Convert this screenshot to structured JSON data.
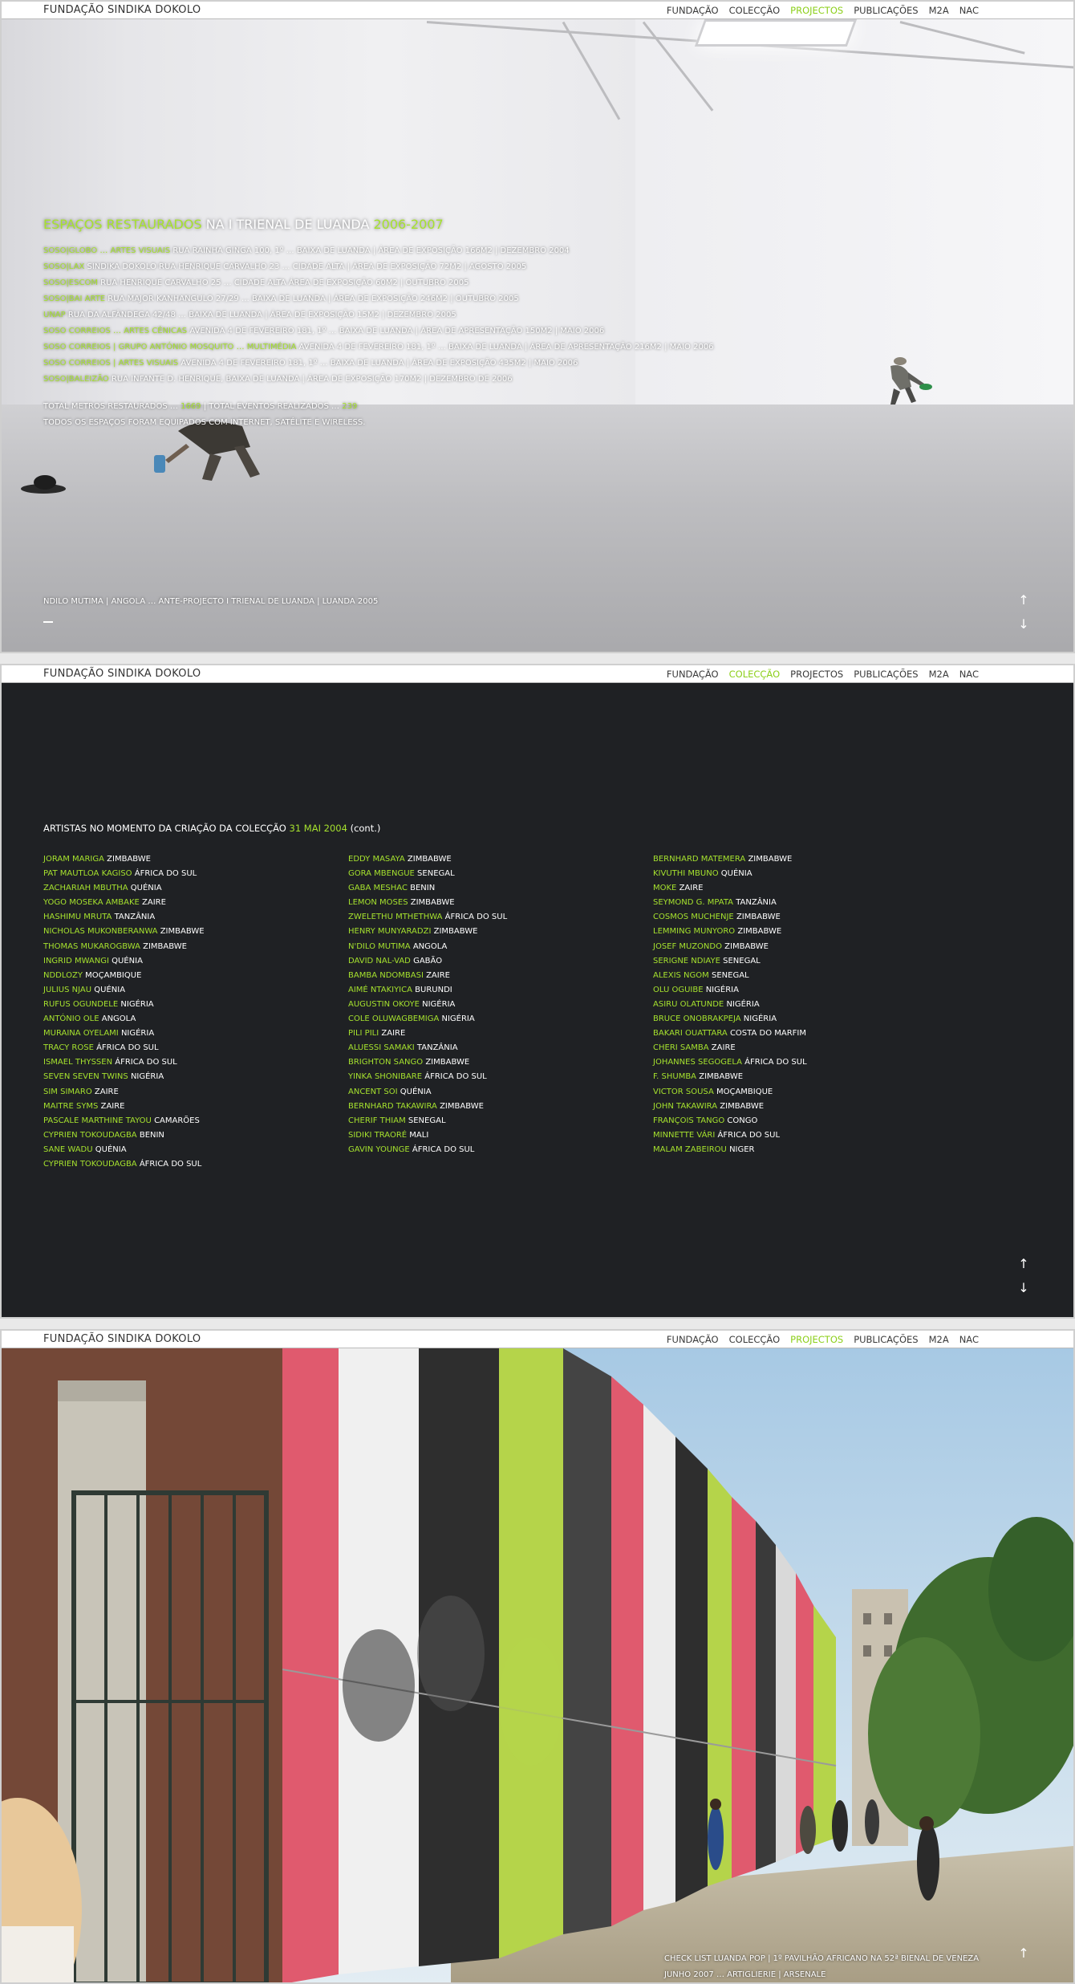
{
  "brand": "FUNDAÇÃO SINDIKA DOKOLO",
  "nav": [
    "FUNDAÇÃO",
    "COLECÇÃO",
    "PROJECTOS",
    "PUBLICAÇÕES",
    "M2A",
    "NAC"
  ],
  "accent_color": "#a6e22e",
  "section1": {
    "active_nav": "PROJECTOS",
    "title": {
      "part1": "ESPAÇOS RESTAURADOS",
      "part2": " NA I TRIENAL DE LUANDA ",
      "part3": "2006-2007"
    },
    "spaces": [
      {
        "name": "SOSO|GLOBO … ARTES VISUAIS",
        "details": " RUA RAINHA GINGA 100, 1º … BAIXA DE LUANDA | ÁREA DE EXPOSIÇÃO 166M2 | DEZEMBRO 2004"
      },
      {
        "name": "SOSO|LAX",
        "details": " SINDIKA DOKOLO RUA HENRIQUE CARVALHO 23 … CIDADE ALTA | ÁREA DE EXPOSIÇÃO 72M2 | AGOSTO 2005"
      },
      {
        "name": "SOSO|ESCOM",
        "details": " RUA HENRIQUE CARVALHO 25 … CIDADE ALTA ÁREA DE EXPOSIÇÃO 60M2 | OUTUBRO 2005"
      },
      {
        "name": "SOSO|BAI ARTE",
        "details": " RUA MAJOR KANHANGULO 27/29 … BAIXA DE LUANDA | ÁREA DE EXPOSIÇÃO 246M2 | OUTUBRO 2005"
      },
      {
        "name": "UNAP",
        "details": " RUA DA ALFÂNDEGA 42/48 … BAIXA DE LUANDA | ÁREA DE EXPOSIÇÃO 15M2 | DEZEMBRO 2005"
      },
      {
        "name": "SOSO CORREIOS … ARTES CÉNICAS",
        "details": " AVENIDA 4 DE FEVEREIRO 181, 1º … BAIXA DE LUANDA | ÁREA DE APRESENTAÇÃO 150M2 | MAIO 2006"
      },
      {
        "name": "SOSO CORREIOS | GRUPO ANTÓNIO MOSQUITO … MULTIMÉDIA",
        "details": " AVENIDA 4 DE FEVEREIRO 181, 1º … BAIXA DE LUANDA | ÁREA DE APRESENTAÇÃO 216M2 | MAIO 2006"
      },
      {
        "name": "SOSO CORREIOS | ARTES VISUAIS",
        "details": " AVENIDA 4 DE FEVEREIRO 181, 1º … BAIXA DE LUANDA | ÁREA DE EXPOSIÇÃO 435M2 | MAIO 2006"
      },
      {
        "name": "SOSO|BALEIZÃO",
        "details": " RUA INFANTE D. HENRIQUE, BAIXA DE LUANDA | ÁREA DE EXPOSIÇÃO 170M2 | DEZEMBRO DE 2006"
      }
    ],
    "totals": {
      "label1": "TOTAL METROS RESTAURADOS … ",
      "value1": "1669",
      "label2": " | TOTAL EVENTOS REALIZADOS … ",
      "value2": "239"
    },
    "equipped_note": "TODOS OS ESPAÇOS FORAM EQUIPADOS COM INTERNET, SATÉLITE E WIRELESS.",
    "caption": "NDILO MUTIMA | ANGOLA … ANTE-PROJECTO I TRIENAL DE LUANDA | LUANDA 2005",
    "arrow_up": "↑",
    "arrow_down": "↓"
  },
  "section2": {
    "active_nav": "COLECÇÃO",
    "heading": {
      "part1": "ARTISTAS NO MOMENTO DA CRIAÇÃO DA COLECÇÃO ",
      "date": "31 MAI 2004",
      "part2": " (cont.)"
    },
    "columns": [
      [
        {
          "name": "JORAM MARIGA",
          "country": "ZIMBABWE"
        },
        {
          "name": "PAT MAUTLOA KAGISO",
          "country": "ÁFRICA DO SUL"
        },
        {
          "name": "ZACHARIAH MBUTHA",
          "country": "QUÉNIA"
        },
        {
          "name": "YOGO MOSEKA AMBAKE",
          "country": "ZAIRE"
        },
        {
          "name": "HASHIMU MRUTA",
          "country": "TANZÂNIA"
        },
        {
          "name": "NICHOLAS MUKONBERANWA",
          "country": "ZIMBABWE"
        },
        {
          "name": "THOMAS MUKAROGBWA",
          "country": "ZIMBABWE"
        },
        {
          "name": "INGRID MWANGI",
          "country": "QUÉNIA"
        },
        {
          "name": "NDDLOZY",
          "country": "MOÇAMBIQUE"
        },
        {
          "name": "JULIUS NJAU",
          "country": "QUÉNIA"
        },
        {
          "name": "RUFUS OGUNDELE",
          "country": "NIGÉRIA"
        },
        {
          "name": "ANTÓNIO OLE",
          "country": "ANGOLA"
        },
        {
          "name": "MURAINA OYELAMI",
          "country": "NIGÉRIA"
        },
        {
          "name": "TRACY ROSE",
          "country": "ÁFRICA DO SUL"
        },
        {
          "name": "ISMAEL THYSSEN",
          "country": "ÁFRICA DO SUL"
        },
        {
          "name": "SEVEN SEVEN TWINS",
          "country": "NIGÉRIA"
        },
        {
          "name": "SIM SIMARO",
          "country": "ZAIRE"
        },
        {
          "name": "MAITRE SYMS",
          "country": "ZAIRE"
        },
        {
          "name": "PASCALE MARTHINE TAYOU",
          "country": "CAMARÕES"
        },
        {
          "name": "CYPRIEN TOKOUDAGBA",
          "country": "BENIN"
        },
        {
          "name": "SANE WADU",
          "country": "QUÉNIA"
        },
        {
          "name": "CYPRIEN TOKOUDAGBA",
          "country": "ÁFRICA DO SUL"
        }
      ],
      [
        {
          "name": "EDDY MASAYA",
          "country": "ZIMBABWE"
        },
        {
          "name": "GORA MBENGUE",
          "country": "SENEGAL"
        },
        {
          "name": "GABA MESHAC",
          "country": "BENIN"
        },
        {
          "name": "LEMON MOSES",
          "country": "ZIMBABWE"
        },
        {
          "name": "ZWELETHU MTHETHWA",
          "country": "ÁFRICA DO SUL"
        },
        {
          "name": "HENRY MUNYARADZI",
          "country": "ZIMBABWE"
        },
        {
          "name": "N'DILO MUTIMA",
          "country": "ANGOLA"
        },
        {
          "name": "DAVID NAL-VAD",
          "country": "GABÃO"
        },
        {
          "name": "BAMBA NDOMBASI",
          "country": "ZAIRE"
        },
        {
          "name": "AIMÉ NTAKIYICA",
          "country": "BURUNDI"
        },
        {
          "name": "AUGUSTIN OKOYE",
          "country": "NIGÉRIA"
        },
        {
          "name": "COLE OLUWAGBEMIGA",
          "country": "NIGÉRIA"
        },
        {
          "name": "PILI PILI",
          "country": "ZAIRE"
        },
        {
          "name": "ALUESSI SAMAKI",
          "country": "TANZÂNIA"
        },
        {
          "name": "BRIGHTON SANGO",
          "country": "ZIMBABWE"
        },
        {
          "name": "YINKA SHONIBARE",
          "country": "ÁFRICA DO SUL"
        },
        {
          "name": "ANCENT SOI",
          "country": "QUÉNIA"
        },
        {
          "name": "BERNHARD TAKAWIRA",
          "country": "ZIMBABWE"
        },
        {
          "name": "CHERIF THIAM",
          "country": "SENEGAL"
        },
        {
          "name": "SIDIKI TRAORÉ",
          "country": "MALI"
        },
        {
          "name": "GAVIN YOUNGE",
          "country": "ÁFRICA DO SUL"
        }
      ],
      [
        {
          "name": "BERNHARD MATEMERA",
          "country": "ZIMBABWE"
        },
        {
          "name": "KIVUTHI MBUNO",
          "country": "QUÉNIA"
        },
        {
          "name": "MOKE",
          "country": "ZAIRE"
        },
        {
          "name": "SEYMOND G. MPATA",
          "country": "TANZÂNIA"
        },
        {
          "name": "COSMOS MUCHENJE",
          "country": "ZIMBABWE"
        },
        {
          "name": "LEMMING MUNYORO",
          "country": "ZIMBABWE"
        },
        {
          "name": "JOSEF MUZONDO",
          "country": "ZIMBABWE"
        },
        {
          "name": "SERIGNE NDIAYE",
          "country": "SENEGAL"
        },
        {
          "name": "ALEXIS NGOM",
          "country": "SENEGAL"
        },
        {
          "name": "OLU OGUIBE",
          "country": "NIGÉRIA"
        },
        {
          "name": "ASIRU OLATUNDE",
          "country": "NIGÉRIA"
        },
        {
          "name": "BRUCE ONOBRAKPEJA",
          "country": "NIGÉRIA"
        },
        {
          "name": "BAKARI OUATTARA",
          "country": "COSTA DO MARFIM"
        },
        {
          "name": "CHERI SAMBA",
          "country": "ZAIRE"
        },
        {
          "name": "JOHANNES SEGOGELA",
          "country": "ÁFRICA DO SUL"
        },
        {
          "name": "F. SHUMBA",
          "country": "ZIMBABWE"
        },
        {
          "name": "VICTOR SOUSA",
          "country": "MOÇAMBIQUE"
        },
        {
          "name": "JOHN TAKAWIRA",
          "country": "ZIMBABWE"
        },
        {
          "name": "FRANÇOIS TANGO",
          "country": "CONGO"
        },
        {
          "name": "MINNETTE VÁRI",
          "country": "ÁFRICA DO SUL"
        },
        {
          "name": "MALAM ZABEIROU",
          "country": "NIGER"
        }
      ]
    ],
    "arrow_up": "↑",
    "arrow_down": "↓"
  },
  "section3": {
    "active_nav": "PROJECTOS",
    "caption_line1": "CHECK LIST LUANDA POP | 1º PAVILHÃO AFRICANO NA 52ª BIENAL DE VENEZA",
    "caption_line2": "JUNHO 2007 … ARTIGLIERIE | ARSENALE",
    "arrow_up": "↑"
  }
}
